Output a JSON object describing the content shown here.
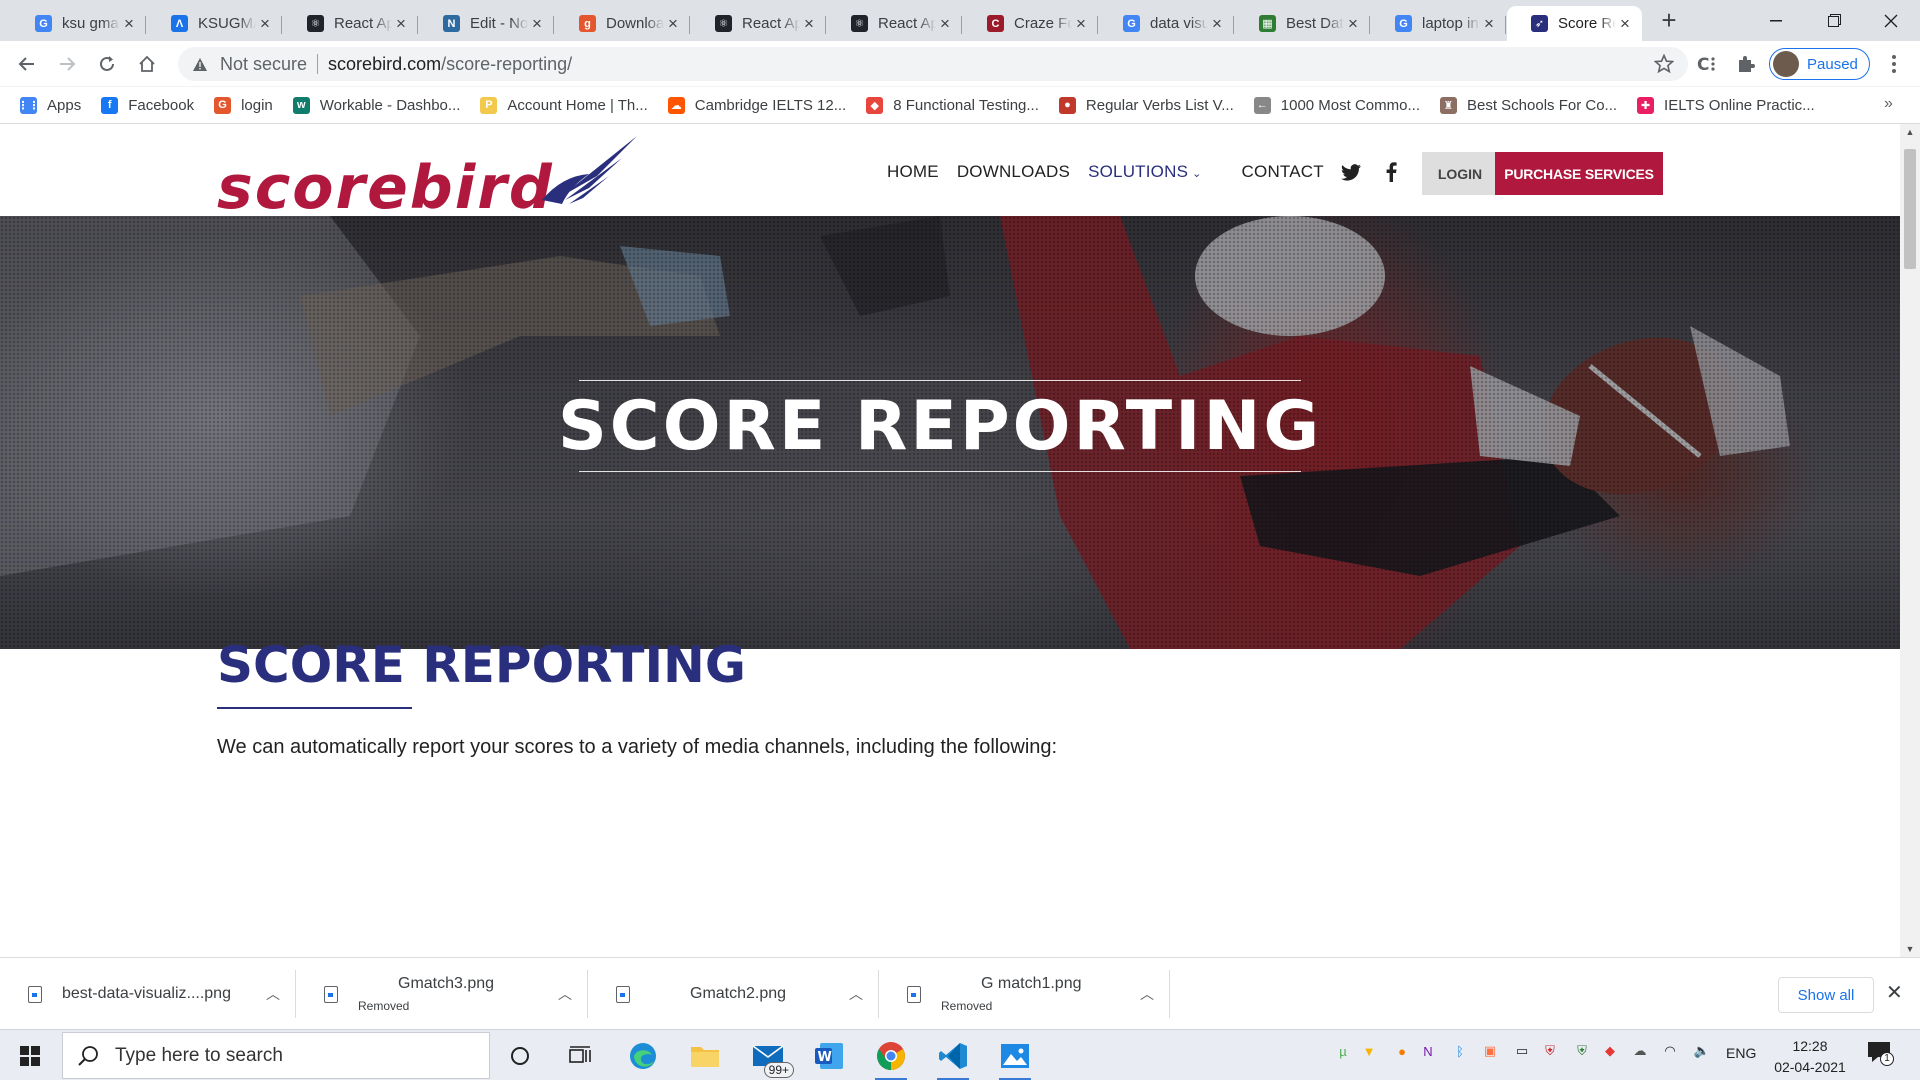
{
  "browser": {
    "tabs": [
      {
        "title": "ksu gmail - Google Search",
        "icon": "google-icon",
        "color": "#4285f4",
        "glyph": "G"
      },
      {
        "title": "KSUGMAIL",
        "icon": "ksu-icon",
        "color": "#1a73e8",
        "glyph": "Λ"
      },
      {
        "title": "React App",
        "icon": "react-icon",
        "color": "#20232a",
        "glyph": "⚛"
      },
      {
        "title": "Edit - Notion",
        "icon": "notion-edit-icon",
        "color": "#2d6a9f",
        "glyph": "N"
      },
      {
        "title": "Download",
        "icon": "download-site-icon",
        "color": "#e4572e",
        "glyph": "g"
      },
      {
        "title": "React App",
        "icon": "react-icon",
        "color": "#20232a",
        "glyph": "⚛"
      },
      {
        "title": "React App",
        "icon": "react-icon",
        "color": "#20232a",
        "glyph": "⚛"
      },
      {
        "title": "Craze Food",
        "icon": "craze-icon",
        "color": "#9b1b2a",
        "glyph": "C"
      },
      {
        "title": "data visualization",
        "icon": "google-icon",
        "color": "#4285f4",
        "glyph": "G"
      },
      {
        "title": "Best Data",
        "icon": "best-data-icon",
        "color": "#2e7d32",
        "glyph": "▦"
      },
      {
        "title": "laptop in",
        "icon": "google-icon",
        "color": "#4285f4",
        "glyph": "G"
      },
      {
        "title": "Score Reporting",
        "icon": "scorebird-icon",
        "color": "#2a2f7d",
        "glyph": "➶"
      }
    ],
    "url": {
      "security": "Not secure",
      "host": "scorebird.com",
      "path": "/score-reporting/"
    },
    "profile_status": "Paused",
    "bookmarks": [
      {
        "label": "Apps",
        "icon": "apps-grid-icon",
        "color": "#4285f4",
        "glyph": "⋮⋮"
      },
      {
        "label": "Facebook",
        "icon": "facebook-icon",
        "color": "#1877f2",
        "glyph": "f"
      },
      {
        "label": "login",
        "icon": "login-icon",
        "color": "#e4572e",
        "glyph": "G"
      },
      {
        "label": "Workable - Dashbo...",
        "icon": "workable-icon",
        "color": "#0f7c6c",
        "glyph": "w"
      },
      {
        "label": "Account Home | Th...",
        "icon": "account-icon",
        "color": "#f2c94c",
        "glyph": "P"
      },
      {
        "label": "Cambridge IELTS 12...",
        "icon": "soundcloud-icon",
        "color": "#ff5500",
        "glyph": "☁"
      },
      {
        "label": "8 Functional Testing...",
        "icon": "testing-icon",
        "color": "#e8453c",
        "glyph": "◆"
      },
      {
        "label": "Regular Verbs List V...",
        "icon": "verbs-icon",
        "color": "#c0392b",
        "glyph": "●"
      },
      {
        "label": "1000 Most Commo...",
        "icon": "arrow-icon",
        "color": "#888888",
        "glyph": "←"
      },
      {
        "label": "Best Schools For Co...",
        "icon": "schools-icon",
        "color": "#8d6e63",
        "glyph": "♜"
      },
      {
        "label": "IELTS Online Practic...",
        "icon": "ielts-icon",
        "color": "#e91e63",
        "glyph": "✚"
      }
    ]
  },
  "site": {
    "brand": "scorebird",
    "nav": {
      "home": "HOME",
      "downloads": "DOWNLOADS",
      "solutions": "SOLUTIONS",
      "contact": "CONTACT"
    },
    "login": "LOGIN",
    "purchase": "PURCHASE SERVICES",
    "hero_title": "SCORE REPORTING",
    "section_title": "SCORE REPORTING",
    "section_text": "We can automatically report your scores to a variety of media channels, including the following:",
    "colors": {
      "brand_red": "#b0183e",
      "brand_navy": "#2a2f7d"
    }
  },
  "downloads": {
    "items": [
      {
        "name": "best-data-visualiz....png",
        "status": ""
      },
      {
        "name": "Gmatch3.png",
        "status": "Removed"
      },
      {
        "name": "Gmatch2.png",
        "status": ""
      },
      {
        "name": "G match1.png",
        "status": "Removed"
      }
    ],
    "show_all": "Show all"
  },
  "taskbar": {
    "search_placeholder": "Type here to search",
    "mail_badge": "99+",
    "language": "ENG",
    "time": "12:28",
    "date": "02-04-2021",
    "notification_count": "1"
  }
}
